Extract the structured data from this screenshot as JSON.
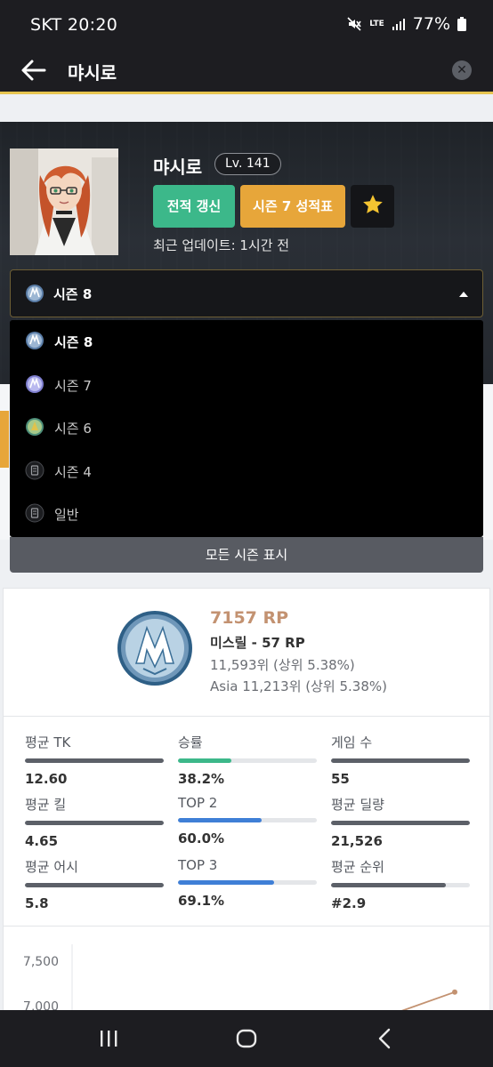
{
  "status_bar": {
    "time": "SKT 20:20",
    "network": "LTE",
    "battery": "77%",
    "icons": [
      "mute-icon",
      "signal-icon",
      "battery-icon"
    ]
  },
  "app_bar": {
    "title": "먀시로",
    "back_icon": "back-arrow-icon",
    "clear_icon": "clear-icon"
  },
  "profile": {
    "name": "먀시로",
    "level": "Lv. 141",
    "refresh_label": "전적 갱신",
    "season_report_label": "시즌 7 성적표",
    "favorite_icon": "star-icon",
    "updated": "최근 업데이트: 1시간 전"
  },
  "season_select": {
    "selected": "시즌 8",
    "options": [
      {
        "label": "시즌 8",
        "icon": "season-8-emblem-icon",
        "selected": true
      },
      {
        "label": "시즌 7",
        "icon": "season-7-emblem-icon",
        "selected": false
      },
      {
        "label": "시즌 6",
        "icon": "season-6-emblem-icon",
        "selected": false
      },
      {
        "label": "시즌 4",
        "icon": "season-4-icon",
        "selected": false
      },
      {
        "label": "일반",
        "icon": "normal-mode-icon",
        "selected": false
      }
    ],
    "show_all_label": "모든 시즌 표시"
  },
  "rank": {
    "rp": "7157 RP",
    "tier": "미스릴 - 57 RP",
    "global_rank": "11,593위 (상위 5.38%)",
    "region_rank": "Asia 11,213위 (상위 5.38%)",
    "emblem": "mithril-emblem-icon"
  },
  "stats": [
    {
      "label": "평균 TK",
      "value": "12.60",
      "fill": 1.0,
      "color": "#5c6068"
    },
    {
      "label": "승률",
      "value": "38.2%",
      "fill": 0.382,
      "color": "#3cb88a"
    },
    {
      "label": "게임 수",
      "value": "55",
      "fill": 1.0,
      "color": "#5c6068"
    },
    {
      "label": "평균 킬",
      "value": "4.65",
      "fill": 1.0,
      "color": "#5c6068"
    },
    {
      "label": "TOP 2",
      "value": "60.0%",
      "fill": 0.6,
      "color": "#3f7fd6"
    },
    {
      "label": "평균 딜량",
      "value": "21,526",
      "fill": 1.0,
      "color": "#5c6068"
    },
    {
      "label": "평균 어시",
      "value": "5.8",
      "fill": 1.0,
      "color": "#5c6068"
    },
    {
      "label": "TOP 3",
      "value": "69.1%",
      "fill": 0.691,
      "color": "#3f7fd6"
    },
    {
      "label": "평균 순위",
      "value": "#2.9",
      "fill": 0.83,
      "color": "#5c6068"
    }
  ],
  "chart_data": {
    "type": "line",
    "y_ticks": [
      "7,500",
      "7,000"
    ],
    "ylim": [
      6500,
      7650
    ],
    "series": [
      {
        "values": [
          6900,
          7157
        ],
        "color": "#c39271"
      }
    ]
  },
  "nav_bar": {
    "icons": [
      "recent-apps-icon",
      "home-icon",
      "back-nav-icon"
    ]
  }
}
